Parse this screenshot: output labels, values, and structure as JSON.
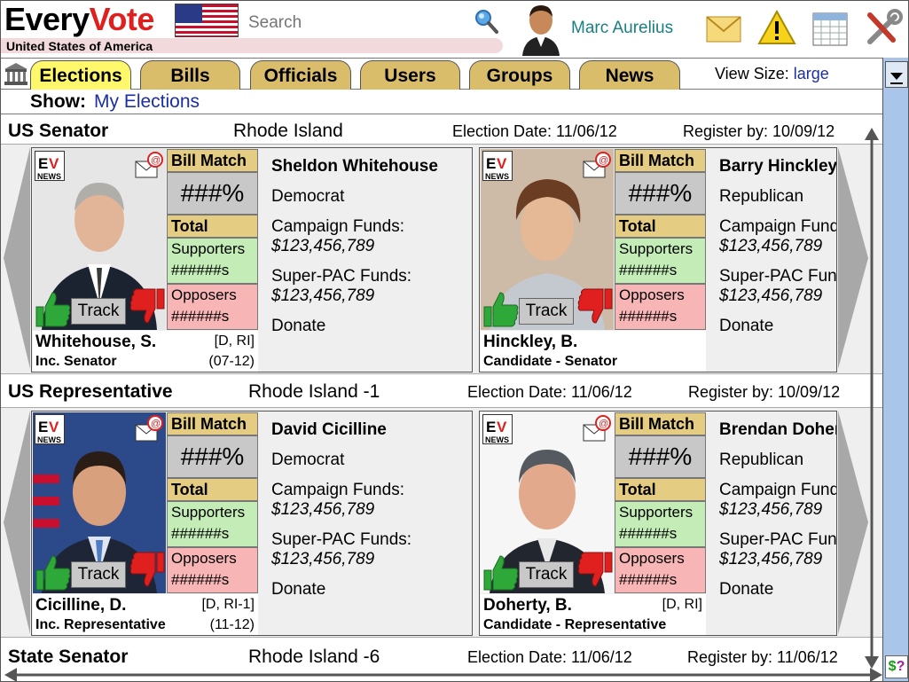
{
  "header": {
    "logo_every": "Every",
    "logo_vote": "Vote",
    "country": "United States of America",
    "search_placeholder": "Search",
    "user_name": "Marc Aurelius",
    "icons": [
      "mail-icon",
      "warning-icon",
      "calendar-icon",
      "tools-icon"
    ]
  },
  "tabs": [
    {
      "label": "Elections",
      "active": true
    },
    {
      "label": "Bills",
      "active": false
    },
    {
      "label": "Officials",
      "active": false
    },
    {
      "label": "Users",
      "active": false
    },
    {
      "label": "Groups",
      "active": false
    },
    {
      "label": "News",
      "active": false
    }
  ],
  "view_size": {
    "label": "View Size:",
    "value": "large"
  },
  "show": {
    "label": "Show",
    "value": "My Elections"
  },
  "sidebar": {
    "money_label": "$?"
  },
  "sections": [
    {
      "office": "US Senator",
      "region": "Rhode Island",
      "election_date": "Election Date: 11/06/12",
      "register_by": "Register by: 10/09/12",
      "cards": [
        {
          "name_full": "Sheldon Whitehouse",
          "party": "Democrat",
          "short_name": "Whitehouse, S.",
          "party_tag": "[D, RI]",
          "role": "Inc. Senator",
          "term": "(07-12)",
          "bill_match_label": "Bill Match",
          "bill_match": "###%",
          "total_label": "Total",
          "supporters_label": "Supporters",
          "supporters": "######s",
          "opposers_label": "Opposers",
          "opposers": "######s",
          "track": "Track",
          "campaign_label": "Campaign Funds:",
          "campaign": "$123,456,789",
          "superpac_label": "Super-PAC Funds:",
          "superpac": "$123,456,789",
          "donate": "Donate",
          "photo_bg": "#d8d8d8"
        },
        {
          "name_full": "Barry Hinckley",
          "party": "Republican",
          "short_name": "Hinckley, B.",
          "party_tag": "",
          "role": "Candidate - Senator",
          "term": "",
          "bill_match_label": "Bill Match",
          "bill_match": "###%",
          "total_label": "Total",
          "supporters_label": "Supporters",
          "supporters": "######s",
          "opposers_label": "Opposers",
          "opposers": "######s",
          "track": "Track",
          "campaign_label": "Campaign Funds:",
          "campaign": "$123,456,789",
          "superpac_label": "Super-PAC Funds:",
          "superpac": "$123,456,789",
          "donate": "Donate",
          "photo_bg": "#c9b6a3"
        }
      ]
    },
    {
      "office": "US Representative",
      "region": "Rhode Island -1",
      "election_date": "Election Date: 11/06/12",
      "register_by": "Register by: 10/09/12",
      "cards": [
        {
          "name_full": "David Cicilline",
          "party": "Democrat",
          "short_name": "Cicilline, D.",
          "party_tag": "[D, RI-1]",
          "role": "Inc. Representative",
          "term": "(11-12)",
          "bill_match_label": "Bill Match",
          "bill_match": "###%",
          "total_label": "Total",
          "supporters_label": "Supporters",
          "supporters": "######s",
          "opposers_label": "Opposers",
          "opposers": "######s",
          "track": "Track",
          "campaign_label": "Campaign Funds:",
          "campaign": "$123,456,789",
          "superpac_label": "Super-PAC Funds:",
          "superpac": "$123,456,789",
          "donate": "Donate",
          "photo_bg": "#3a5596"
        },
        {
          "name_full": "Brendan Doherty",
          "party": "Republican",
          "short_name": "Doherty, B.",
          "party_tag": "[D, RI]",
          "role": "Candidate - Representative",
          "term": "",
          "bill_match_label": "Bill Match",
          "bill_match": "###%",
          "total_label": "Total",
          "supporters_label": "Supporters",
          "supporters": "######s",
          "opposers_label": "Opposers",
          "opposers": "######s",
          "track": "Track",
          "campaign_label": "Campaign Funds:",
          "campaign": "$123,456,789",
          "superpac_label": "Super-PAC Funds:",
          "superpac": "$123,456,789",
          "donate": "Donate",
          "photo_bg": "#f4f4f4"
        }
      ]
    },
    {
      "office": "State Senator",
      "region": "Rhode Island -6",
      "election_date": "Election Date: 11/06/12",
      "register_by": "Register by: 11/06/12",
      "cards": []
    }
  ]
}
